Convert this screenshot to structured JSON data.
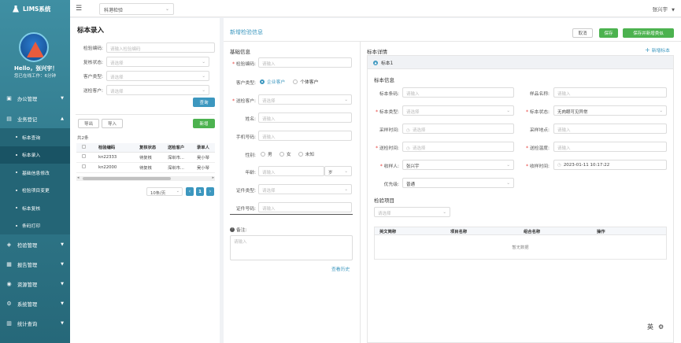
{
  "app": {
    "name": "LIMS系统"
  },
  "user": {
    "greeting": "Hello，张兴宇！",
    "online": "您已在线工作：6分钟",
    "top_name": "张兴宇"
  },
  "topbar": {
    "dept": "科港检验"
  },
  "sidebar": {
    "menus": [
      {
        "label": "办公管理",
        "icon": "office-icon"
      },
      {
        "label": "业务登记",
        "icon": "register-icon"
      }
    ],
    "subs": [
      "标本查询",
      "标本录入",
      "基础信息修改",
      "检验项目变更",
      "标本复核",
      "条码打印"
    ],
    "menus2": [
      {
        "label": "检验管理",
        "icon": "inspection-icon"
      },
      {
        "label": "报告管理",
        "icon": "report-icon"
      },
      {
        "label": "资源管理",
        "icon": "resource-icon"
      },
      {
        "label": "系统管理",
        "icon": "system-icon"
      },
      {
        "label": "统计查询",
        "icon": "stats-icon"
      }
    ]
  },
  "left": {
    "title": "标本录入",
    "filters": [
      {
        "label": "检验编码:",
        "placeholder": "请输入检验编码",
        "type": "input"
      },
      {
        "label": "复核状态:",
        "placeholder": "请选择",
        "type": "select"
      },
      {
        "label": "客户类型:",
        "placeholder": "请选择",
        "type": "select"
      },
      {
        "label": "送检客户:",
        "placeholder": "请选择",
        "type": "select"
      }
    ],
    "query": "查询",
    "export": "导出",
    "import": "导入",
    "add": "新增",
    "total": "共2条",
    "columns": [
      "检验编码",
      "复核状态",
      "送检客户",
      "录单人"
    ],
    "rows": [
      [
        "kn22333",
        "待复核",
        "深圳市...",
        "吴小琴"
      ],
      [
        "kn22000",
        "待复核",
        "深圳市...",
        "吴小琴"
      ]
    ],
    "page_size": "10条/页",
    "page": "1"
  },
  "right": {
    "title": "新增检验信息",
    "cancel": "取消",
    "save": "保存",
    "save_add": "保存并新增类似",
    "basic_title": "基础信息",
    "basic": {
      "code_label": "检验编码:",
      "code_ph": "请输入",
      "ctype_label": "客户类型:",
      "ctype_opt1": "企业客户",
      "ctype_opt2": "个体客户",
      "client_label": "送检客户:",
      "client_ph": "请选择",
      "name_label": "姓名:",
      "name_ph": "请输入",
      "phone_label": "手机号码:",
      "phone_ph": "请输入",
      "gender_label": "性别:",
      "g_male": "男",
      "g_female": "女",
      "g_unknown": "未知",
      "age_label": "年龄:",
      "age_ph": "请输入",
      "age_unit": "岁",
      "idtype_label": "证件类型:",
      "idtype_ph": "请选择",
      "idno_label": "证件号码:",
      "idno_ph": "请输入",
      "remark_label": "备注:",
      "remark_ph": "请输入",
      "history": "查看历史"
    },
    "detail_title": "标本详情",
    "add_sample": "新增标本",
    "sample_tab": "标本1",
    "sample_info": "标本信息",
    "fields": {
      "barcode_label": "标本条码:",
      "barcode_ph": "请输入",
      "sname_label": "样品名称:",
      "sname_ph": "请输入",
      "stype_label": "标本类型:",
      "stype_ph": "请选择",
      "sstatus_label": "标本状态:",
      "sstatus_val": "无肉眼可见异常",
      "ctime_label": "采样时间:",
      "ctime_ph": "请选择",
      "cplace_label": "采样地点:",
      "cplace_ph": "请输入",
      "stime_label": "送检时间:",
      "stime_ph": "请选择",
      "stemp_label": "送检温度:",
      "stemp_ph": "请输入",
      "receiver_label": "收样人:",
      "receiver_val": "张兴宇",
      "rtime_label": "收样时间:",
      "rtime_val": "2023-01-11 10:17:22",
      "priority_label": "优先级:",
      "priority_val": "普通"
    },
    "items_title": "检验项目",
    "items_ph": "请选择",
    "items_cols": [
      "英文简称",
      "项目名称",
      "组合名称",
      "操作"
    ],
    "no_data": "暂无数据"
  },
  "corner": {
    "lang": "英"
  }
}
